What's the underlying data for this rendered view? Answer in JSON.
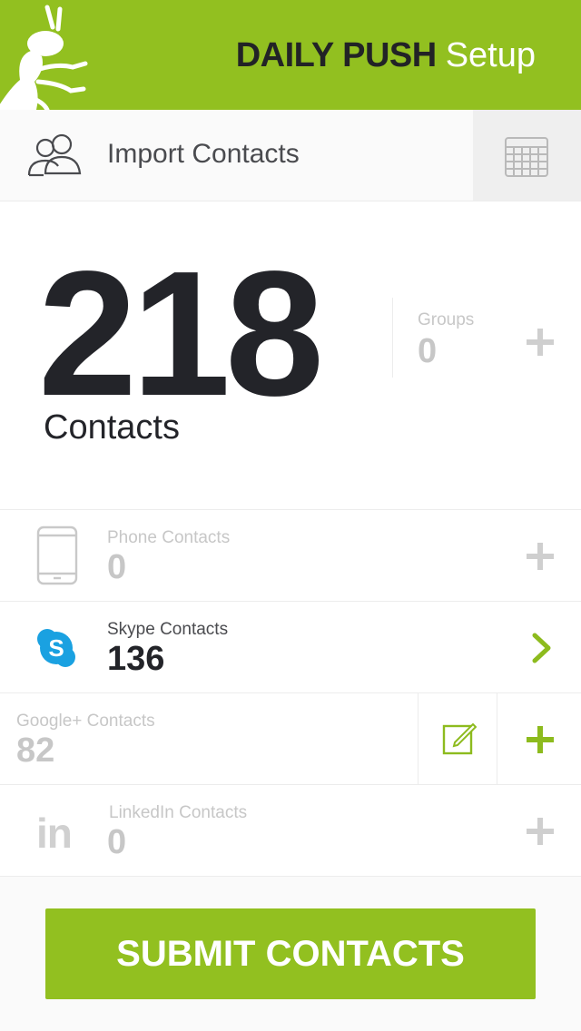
{
  "header": {
    "brand": "DAILY PUSH",
    "subtitle": "Setup",
    "logo_icon": "ant-logo-icon"
  },
  "import": {
    "label": "Import Contacts",
    "people_icon": "people-icon",
    "calendar_icon": "calendar-icon"
  },
  "totals": {
    "contacts_count": "218",
    "contacts_label": "Contacts",
    "groups_label": "Groups",
    "groups_count": "0"
  },
  "sources": [
    {
      "label": "Phone Contacts",
      "count": "0",
      "icon": "phone-icon",
      "action": "add"
    },
    {
      "label": "Skype Contacts",
      "count": "136",
      "icon": "skype-icon",
      "action": "open"
    },
    {
      "label": "Google+ Contacts",
      "count": "82",
      "icon": "",
      "action": "edit-add"
    },
    {
      "label": "LinkedIn Contacts",
      "count": "0",
      "icon": "linkedin-icon",
      "icon_text": "in",
      "action": "add"
    }
  ],
  "submit": {
    "label": "SUBMIT CONTACTS"
  },
  "colors": {
    "accent": "#92c020",
    "dark": "#232429",
    "muted": "#c7c7c7",
    "skype": "#1aa1e1"
  }
}
